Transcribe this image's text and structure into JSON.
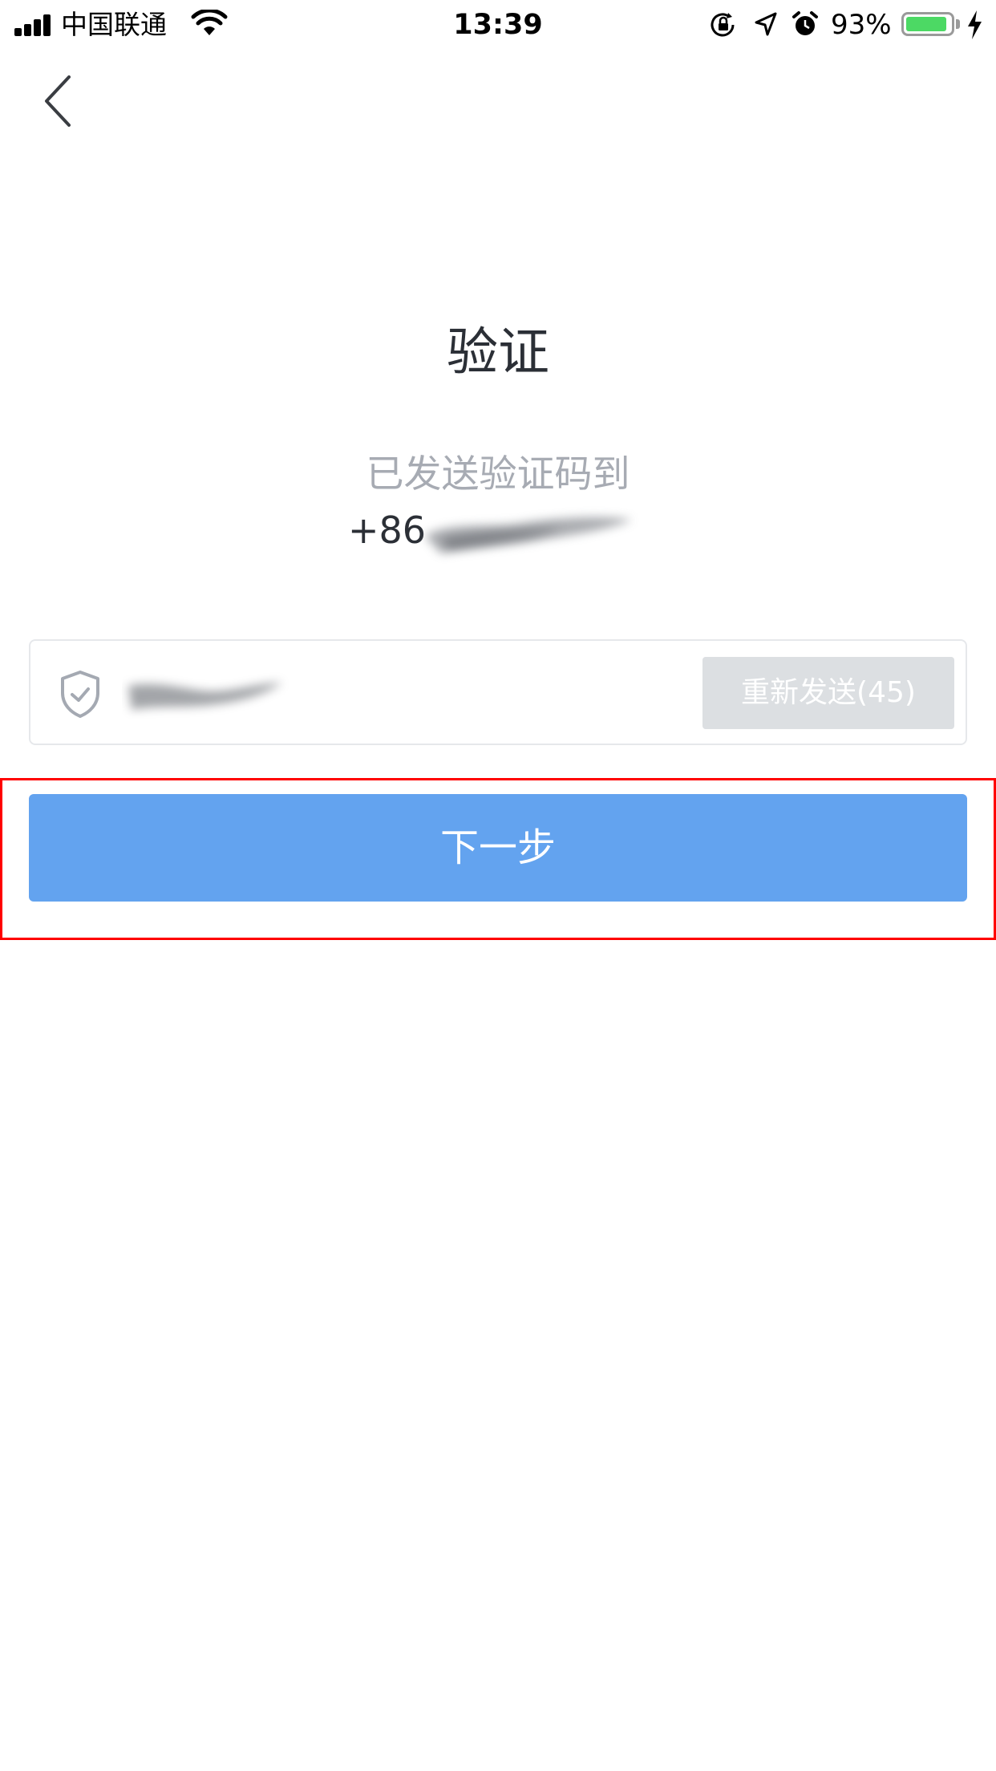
{
  "status_bar": {
    "carrier": "中国联通",
    "time": "13:39",
    "battery_percent": "93%",
    "battery_level": 0.93,
    "icons": [
      "signal-icon",
      "wifi-icon",
      "rotation-lock-icon",
      "location-icon",
      "alarm-icon",
      "battery-icon",
      "charging-icon"
    ]
  },
  "nav": {
    "back_icon": "chevron-left-icon"
  },
  "main": {
    "title": "验证",
    "sent_hint": "已发送验证码到",
    "country_code": "+86",
    "code_icon": "shield-check-icon",
    "resend_label": "重新发送(45)",
    "next_label": "下一步"
  },
  "colors": {
    "primary_button": "#63a3ef",
    "resend_disabled": "#dcdfe2",
    "hint_text": "#a7abb3",
    "highlight": "#ff0000",
    "battery_fill": "#4cd964"
  }
}
